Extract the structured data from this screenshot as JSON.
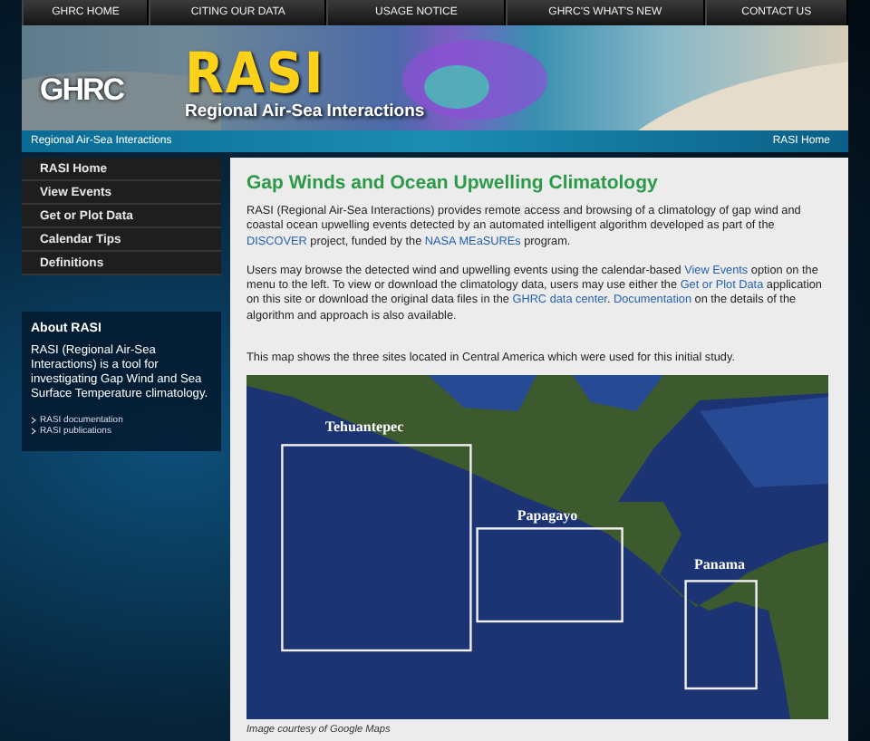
{
  "top_nav": [
    {
      "label": "GHRC HOME"
    },
    {
      "label": "CITING OUR DATA"
    },
    {
      "label": "USAGE NOTICE"
    },
    {
      "label": "GHRC'S WHAT'S NEW"
    },
    {
      "label": "CONTACT US"
    }
  ],
  "banner": {
    "logo": "GHRC",
    "title": "RASI",
    "subtitle": "Regional Air-Sea Interactions"
  },
  "breadcrumb_bar": {
    "site": "Regional Air-Sea Interactions",
    "home_link": "RASI Home"
  },
  "sidebar": {
    "menu": [
      {
        "label": "RASI Home"
      },
      {
        "label": "View Events"
      },
      {
        "label": "Get or Plot Data"
      },
      {
        "label": "Calendar Tips"
      },
      {
        "label": "Definitions"
      }
    ],
    "about": {
      "heading": "About RASI",
      "text": "RASI (Regional Air-Sea Interactions) is a tool for investigating Gap Wind and Sea Surface Temperature climatology.",
      "links": [
        "RASI documentation",
        "RASI publications"
      ]
    }
  },
  "content": {
    "title": "Gap Winds and Ocean Upwelling Climatology",
    "paragraphs": [
      [
        {
          "text": "RASI (Regional Air-Sea Interactions) provides remote access and browsing of a climatology of gap wind and coastal ocean upwelling events detected by an automated intelligent algorithm developed as part of the ",
          "link": false
        },
        {
          "text": "DISCOVER",
          "link": true
        },
        {
          "text": " project, funded by the ",
          "link": false
        },
        {
          "text": "NASA MEaSUREs",
          "link": true
        },
        {
          "text": " program.",
          "link": false
        }
      ],
      [
        {
          "text": "Users may browse the detected wind and upwelling events using the calendar-based ",
          "link": false
        },
        {
          "text": "View Events",
          "link": true
        },
        {
          "text": " option on the menu to the left. To view or download the climatology data, users may use either the ",
          "link": false
        },
        {
          "text": "Get or Plot Data",
          "link": true
        },
        {
          "text": " application on this site or download the original data files in the ",
          "link": false
        },
        {
          "text": "GHRC data center",
          "link": true
        },
        {
          "text": ". ",
          "link": false
        },
        {
          "text": "Documentation",
          "link": true
        },
        {
          "text": " on the details of the algorithm and approach is also available.",
          "link": false
        }
      ],
      [
        {
          "text": "This map shows the three sites located in Central America which were used for this initial study.",
          "link": false
        }
      ]
    ],
    "map": {
      "sites": [
        {
          "label": "Tehuantepec"
        },
        {
          "label": "Papagayo"
        },
        {
          "label": "Panama"
        }
      ]
    },
    "caption": "Image courtesy of Google Maps"
  }
}
